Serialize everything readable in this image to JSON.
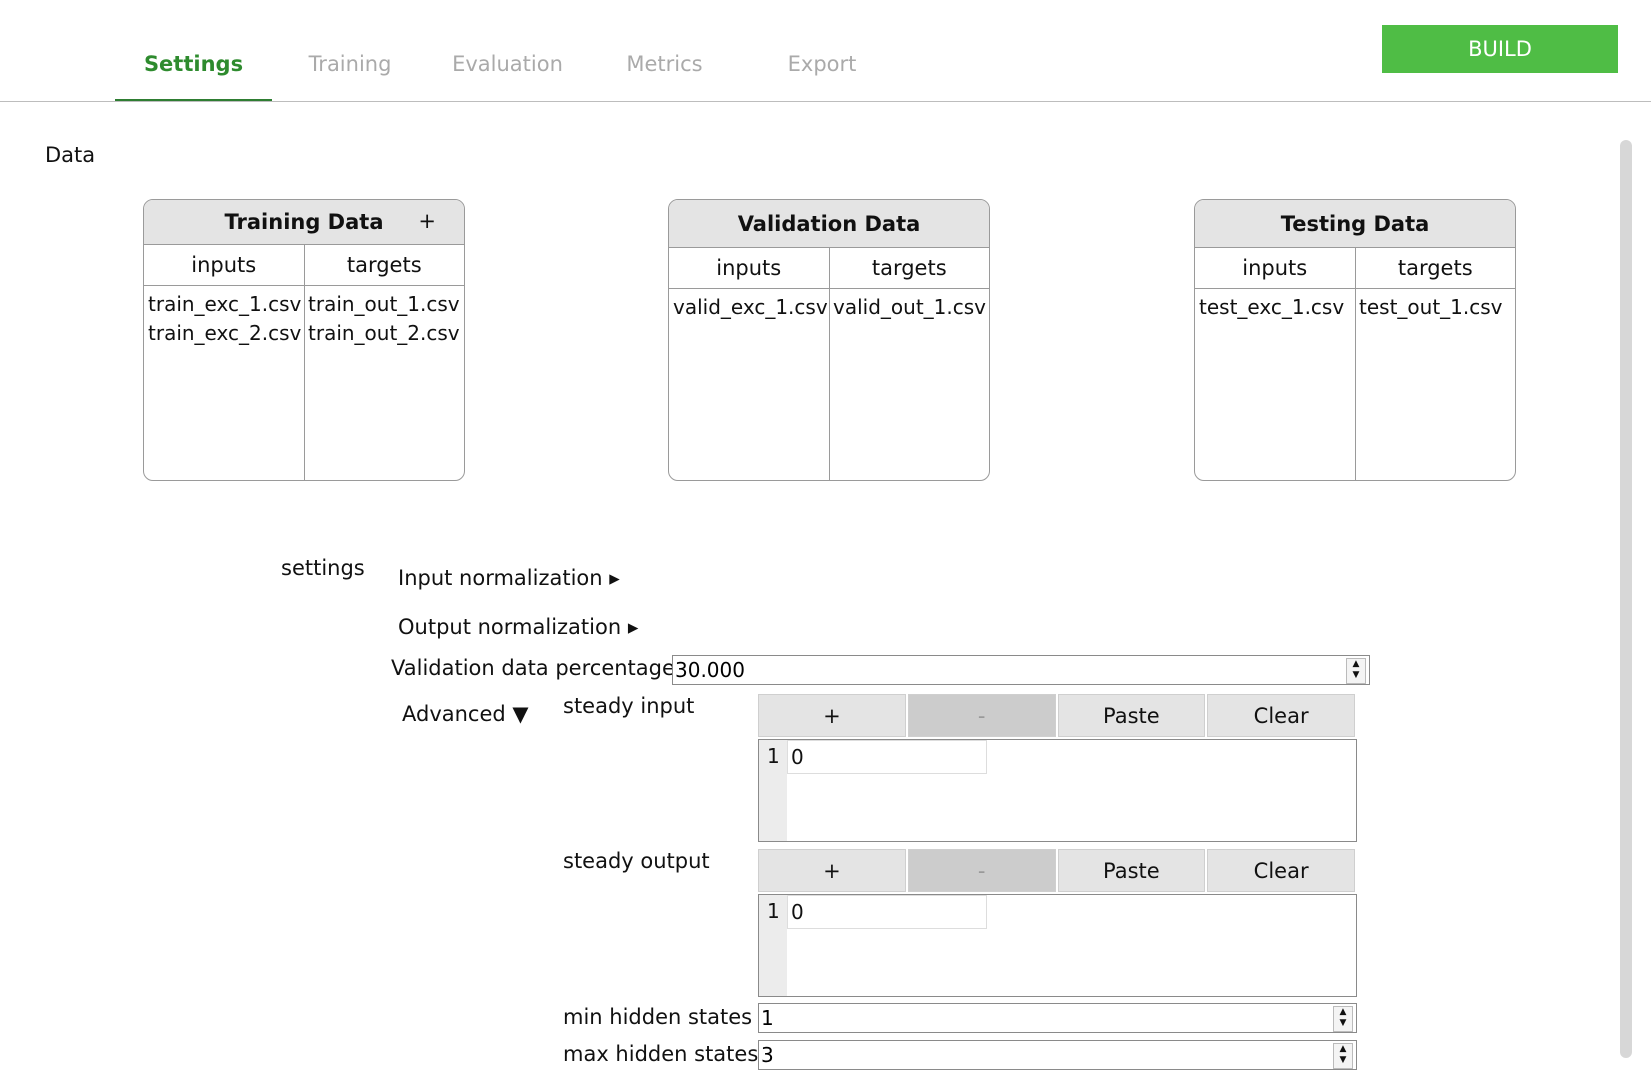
{
  "tabs": [
    {
      "label": "Settings"
    },
    {
      "label": "Training"
    },
    {
      "label": "Evaluation"
    },
    {
      "label": "Metrics"
    },
    {
      "label": "Export"
    }
  ],
  "build_label": "BUILD",
  "data_section_label": "Data",
  "training": {
    "title": "Training Data",
    "add": "+",
    "col_inputs": "inputs",
    "col_targets": "targets",
    "inputs": [
      "train_exc_1.csv",
      "train_exc_2.csv"
    ],
    "targets": [
      "train_out_1.csv",
      "train_out_2.csv"
    ]
  },
  "validation": {
    "title": "Validation Data",
    "col_inputs": "inputs",
    "col_targets": "targets",
    "inputs": [
      "valid_exc_1.csv"
    ],
    "targets": [
      "valid_out_1.csv"
    ]
  },
  "testing": {
    "title": "Testing Data",
    "col_inputs": "inputs",
    "col_targets": "targets",
    "inputs": [
      "test_exc_1.csv"
    ],
    "targets": [
      "test_out_1.csv"
    ]
  },
  "settings": {
    "label": "settings",
    "input_norm": "Input normalization ▸",
    "output_norm": "Output normalization ▸",
    "valid_pct_label": "Validation data percentage",
    "valid_pct_value": "30.000",
    "advanced": "Advanced ▼",
    "steady_input": {
      "label": "steady input",
      "row": "1",
      "value": "0"
    },
    "steady_output": {
      "label": "steady output",
      "row": "1",
      "value": "0"
    },
    "toolbar": {
      "add": "+",
      "remove": "-",
      "paste": "Paste",
      "clear": "Clear"
    },
    "min_hidden_label": "min hidden states",
    "min_hidden_value": "1",
    "max_hidden_label": "max hidden states",
    "max_hidden_value": "3"
  },
  "colors": {
    "accent": "#2e7d32",
    "build": "#4fbd45"
  }
}
